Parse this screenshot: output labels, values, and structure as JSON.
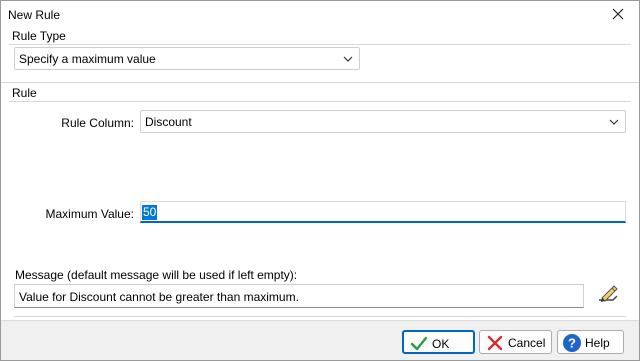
{
  "window": {
    "title": "New Rule"
  },
  "rule_type": {
    "group_label": "Rule Type",
    "selected": "Specify a maximum value"
  },
  "rule": {
    "group_label": "Rule",
    "column_label": "Rule Column:",
    "column_value": "Discount",
    "max_label": "Maximum Value:",
    "max_value": "50"
  },
  "message": {
    "label": "Message (default message will be used if left empty):",
    "value": "Value for Discount cannot be greater than maximum."
  },
  "buttons": {
    "ok": "OK",
    "cancel": "Cancel",
    "help": "Help"
  },
  "colors": {
    "accent": "#0067c0",
    "ok_check": "#2e9b3b",
    "cancel_x": "#d32f2f",
    "help_circle": "#1f64c8"
  }
}
